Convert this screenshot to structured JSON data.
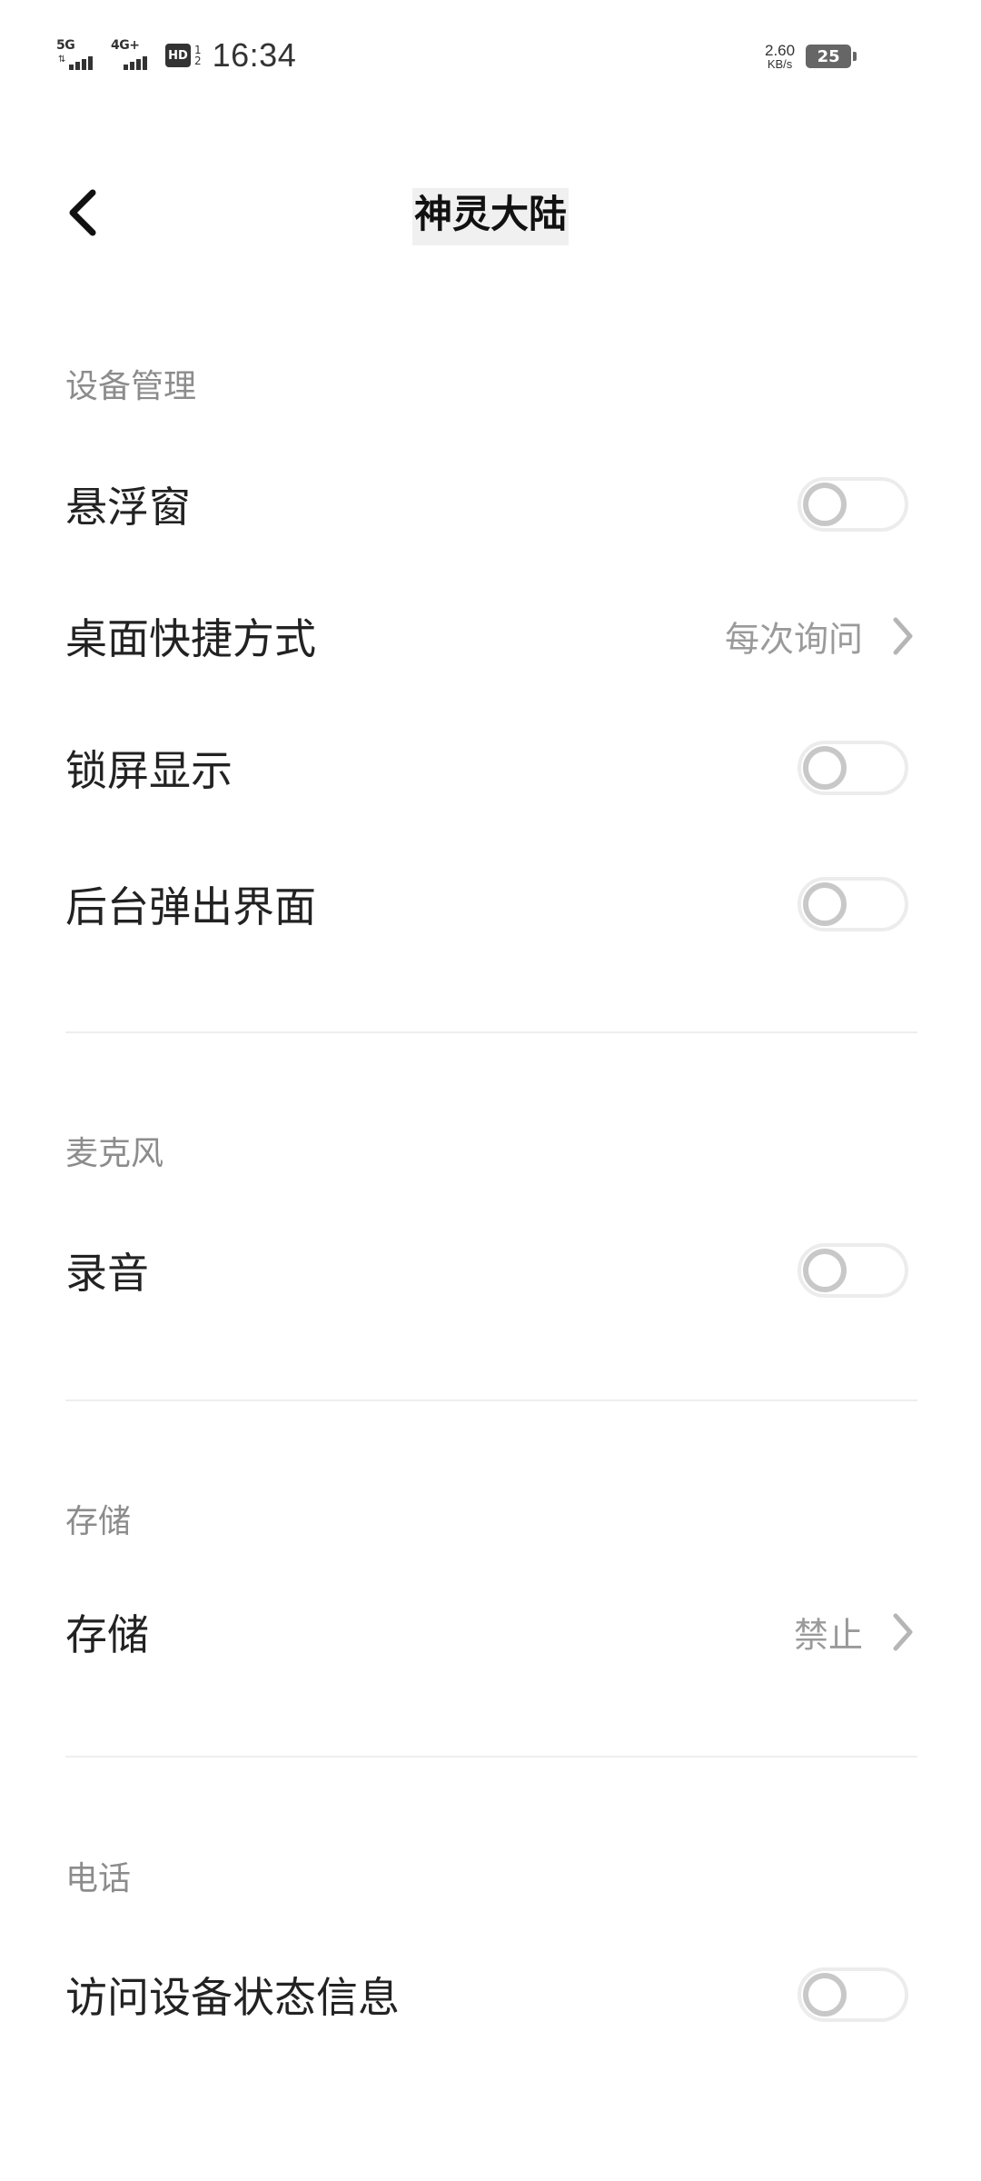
{
  "status_bar": {
    "signal1_label": "5G",
    "signal2_label": "4G+",
    "hd_label": "HD",
    "hd_sub_top": "1",
    "hd_sub_bottom": "2",
    "time": "16:34",
    "net_speed_value": "2.60",
    "net_speed_unit": "KB/s",
    "battery_level": "25"
  },
  "header": {
    "back_icon": "chevron-left-icon",
    "title": "神灵大陆"
  },
  "sections": {
    "device": {
      "title": "设备管理",
      "floating_window": {
        "label": "悬浮窗",
        "enabled": false
      },
      "desktop_shortcut": {
        "label": "桌面快捷方式",
        "value": "每次询问"
      },
      "lock_screen": {
        "label": "锁屏显示",
        "enabled": false
      },
      "background_popup": {
        "label": "后台弹出界面",
        "enabled": false
      }
    },
    "microphone": {
      "title": "麦克风",
      "record_audio": {
        "label": "录音",
        "enabled": false
      }
    },
    "storage": {
      "title": "存储",
      "storage_item": {
        "label": "存储",
        "value": "禁止"
      }
    },
    "phone": {
      "title": "电话",
      "device_status": {
        "label": "访问设备状态信息",
        "enabled": false
      }
    }
  },
  "colors": {
    "background": "#ffffff",
    "section_title": "#8c8c8c",
    "value_text": "#9a9a9a",
    "toggle_off_track": "#ececec",
    "toggle_off_knob": "#c8c8c8"
  }
}
